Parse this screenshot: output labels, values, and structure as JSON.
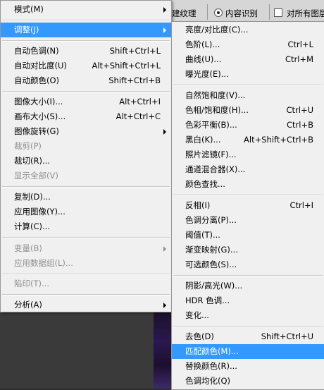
{
  "options_bar": {
    "partial_label": "建纹理",
    "content_aware_label": "内容识别",
    "sample_all_label": "对所有图层"
  },
  "left_menu": {
    "items": [
      {
        "label": "模式(M)",
        "shortcut": "",
        "submenu": true,
        "disabled": false
      },
      {
        "label": "调整(J)",
        "shortcut": "",
        "submenu": true,
        "disabled": false,
        "highlighted": true
      },
      {
        "label": "自动色调(N)",
        "shortcut": "Shift+Ctrl+L",
        "disabled": false
      },
      {
        "label": "自动对比度(U)",
        "shortcut": "Alt+Shift+Ctrl+L",
        "disabled": false
      },
      {
        "label": "自动颜色(O)",
        "shortcut": "Shift+Ctrl+B",
        "disabled": false
      },
      {
        "label": "图像大小(I)...",
        "shortcut": "Alt+Ctrl+I",
        "disabled": false
      },
      {
        "label": "画布大小(S)...",
        "shortcut": "Alt+Ctrl+C",
        "disabled": false
      },
      {
        "label": "图像旋转(G)",
        "shortcut": "",
        "submenu": true,
        "disabled": false
      },
      {
        "label": "裁剪(P)",
        "shortcut": "",
        "disabled": true
      },
      {
        "label": "裁切(R)...",
        "shortcut": "",
        "disabled": false
      },
      {
        "label": "显示全部(V)",
        "shortcut": "",
        "disabled": true
      },
      {
        "label": "复制(D)...",
        "shortcut": "",
        "disabled": false
      },
      {
        "label": "应用图像(Y)...",
        "shortcut": "",
        "disabled": false
      },
      {
        "label": "计算(C)...",
        "shortcut": "",
        "disabled": false
      },
      {
        "label": "变量(B)",
        "shortcut": "",
        "submenu": true,
        "disabled": true
      },
      {
        "label": "应用数据组(L)...",
        "shortcut": "",
        "disabled": true
      },
      {
        "label": "陷印(T)...",
        "shortcut": "",
        "disabled": true
      },
      {
        "label": "分析(A)",
        "shortcut": "",
        "submenu": true,
        "disabled": false
      }
    ]
  },
  "right_menu": {
    "items": [
      {
        "label": "亮度/对比度(C)...",
        "shortcut": ""
      },
      {
        "label": "色阶(L)...",
        "shortcut": "Ctrl+L"
      },
      {
        "label": "曲线(U)...",
        "shortcut": "Ctrl+M"
      },
      {
        "label": "曝光度(E)...",
        "shortcut": ""
      },
      {
        "label": "自然饱和度(V)...",
        "shortcut": ""
      },
      {
        "label": "色相/饱和度(H)...",
        "shortcut": "Ctrl+U"
      },
      {
        "label": "色彩平衡(B)...",
        "shortcut": "Ctrl+B"
      },
      {
        "label": "黑白(K)...",
        "shortcut": "Alt+Shift+Ctrl+B"
      },
      {
        "label": "照片滤镜(F)...",
        "shortcut": ""
      },
      {
        "label": "通道混合器(X)...",
        "shortcut": ""
      },
      {
        "label": "颜色查找...",
        "shortcut": ""
      },
      {
        "label": "反相(I)",
        "shortcut": "Ctrl+I"
      },
      {
        "label": "色调分离(P)...",
        "shortcut": ""
      },
      {
        "label": "阈值(T)...",
        "shortcut": ""
      },
      {
        "label": "渐变映射(G)...",
        "shortcut": ""
      },
      {
        "label": "可选颜色(S)...",
        "shortcut": ""
      },
      {
        "label": "阴影/高光(W)...",
        "shortcut": ""
      },
      {
        "label": "HDR 色调...",
        "shortcut": ""
      },
      {
        "label": "变化...",
        "shortcut": ""
      },
      {
        "label": "去色(D)",
        "shortcut": "Shift+Ctrl+U"
      },
      {
        "label": "匹配颜色(M)...",
        "shortcut": "",
        "selected": true
      },
      {
        "label": "替换颜色(R)...",
        "shortcut": ""
      },
      {
        "label": "色调均化(Q)",
        "shortcut": ""
      }
    ]
  },
  "colors": {
    "menu_bg": "#f0f0f0",
    "highlight": "#3399ff",
    "disabled_text": "#8f8f8f"
  }
}
